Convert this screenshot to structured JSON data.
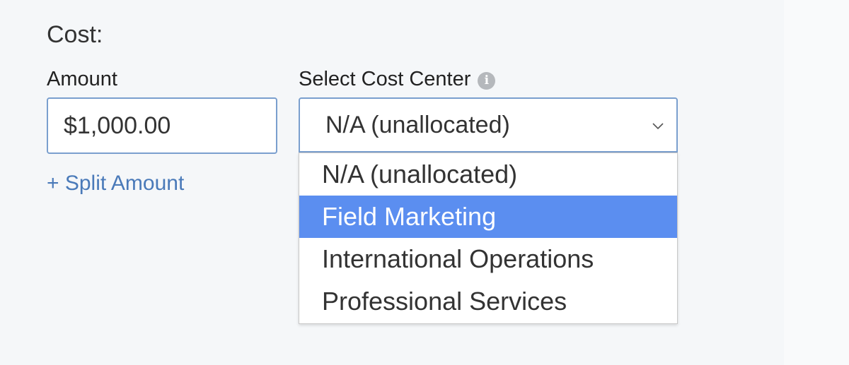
{
  "section": {
    "title": "Cost:"
  },
  "amount": {
    "label": "Amount",
    "value": "$1,000.00"
  },
  "split": {
    "label": "+ Split Amount"
  },
  "cost_center": {
    "label": "Select Cost Center",
    "info_icon": "info-icon",
    "selected": "N/A (unallocated)",
    "options": [
      "N/A (unallocated)",
      "Field Marketing",
      "International Operations",
      "Professional Services"
    ],
    "highlighted_option": "Field Marketing"
  },
  "colors": {
    "input_border": "#7a9fce",
    "highlight": "#5b8ef0",
    "link": "#4a7ab9",
    "background": "#f5f7f9"
  }
}
